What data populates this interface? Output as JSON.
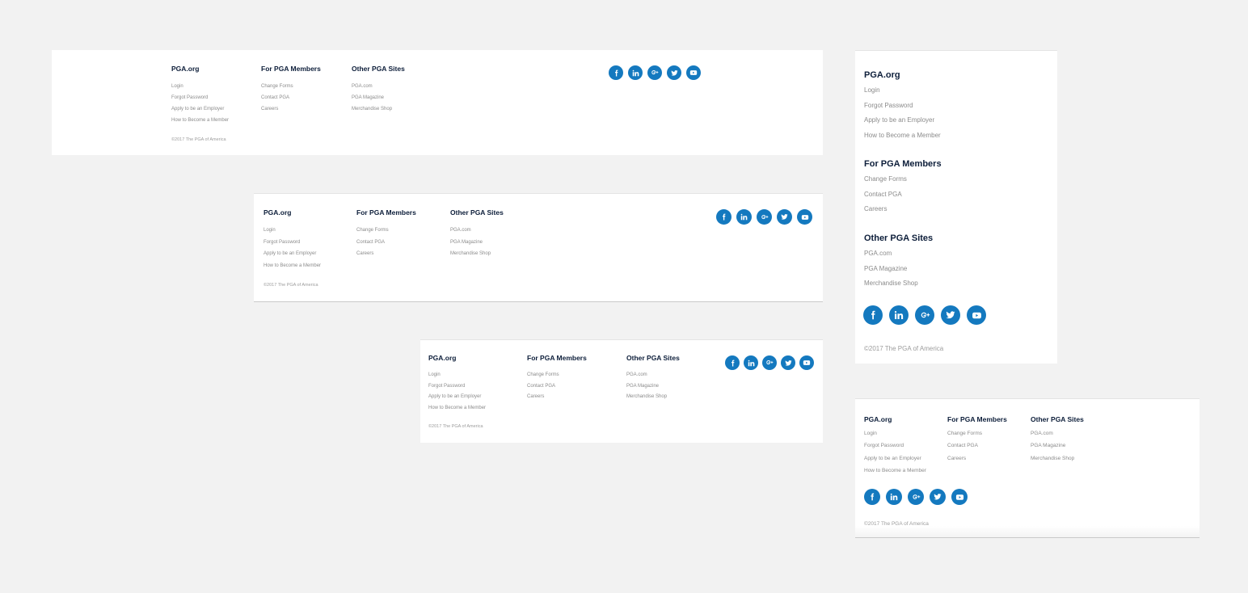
{
  "footer": {
    "columns": [
      {
        "heading": "PGA.org",
        "links": [
          "Login",
          "Forgot Password",
          "Apply to be an Employer",
          "How to Become a Member"
        ]
      },
      {
        "heading": "For PGA Members",
        "links": [
          "Change Forms",
          "Contact PGA",
          "Careers"
        ]
      },
      {
        "heading": "Other PGA Sites",
        "links": [
          "PGA.com",
          "PGA Magazine",
          "Merchandise Shop"
        ]
      }
    ],
    "copyright": "©2017 The PGA of America",
    "social": [
      "facebook-icon",
      "linkedin-icon",
      "google-plus-icon",
      "twitter-icon",
      "youtube-icon"
    ]
  },
  "colors": {
    "background": "#f2f2f2",
    "panel": "#ffffff",
    "heading": "#0d1e3a",
    "link": "#8b8b8b",
    "accent": "#1479bf"
  }
}
